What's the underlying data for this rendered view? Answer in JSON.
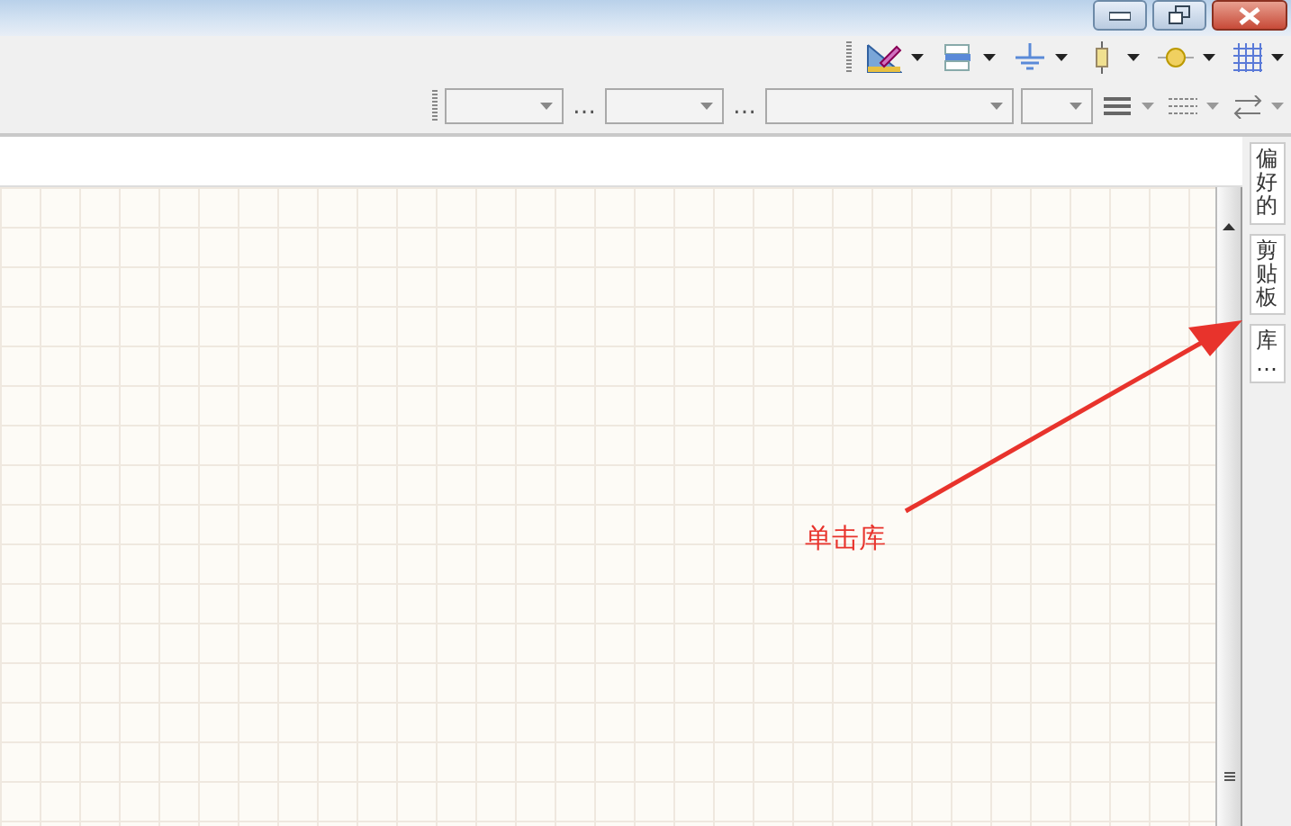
{
  "format_bar": {
    "separators": [
      "…",
      "…"
    ]
  },
  "side_tabs": [
    {
      "label": "偏好的"
    },
    {
      "label": "剪贴板"
    },
    {
      "label": "库…"
    }
  ],
  "annotation": {
    "label": "单击库"
  }
}
